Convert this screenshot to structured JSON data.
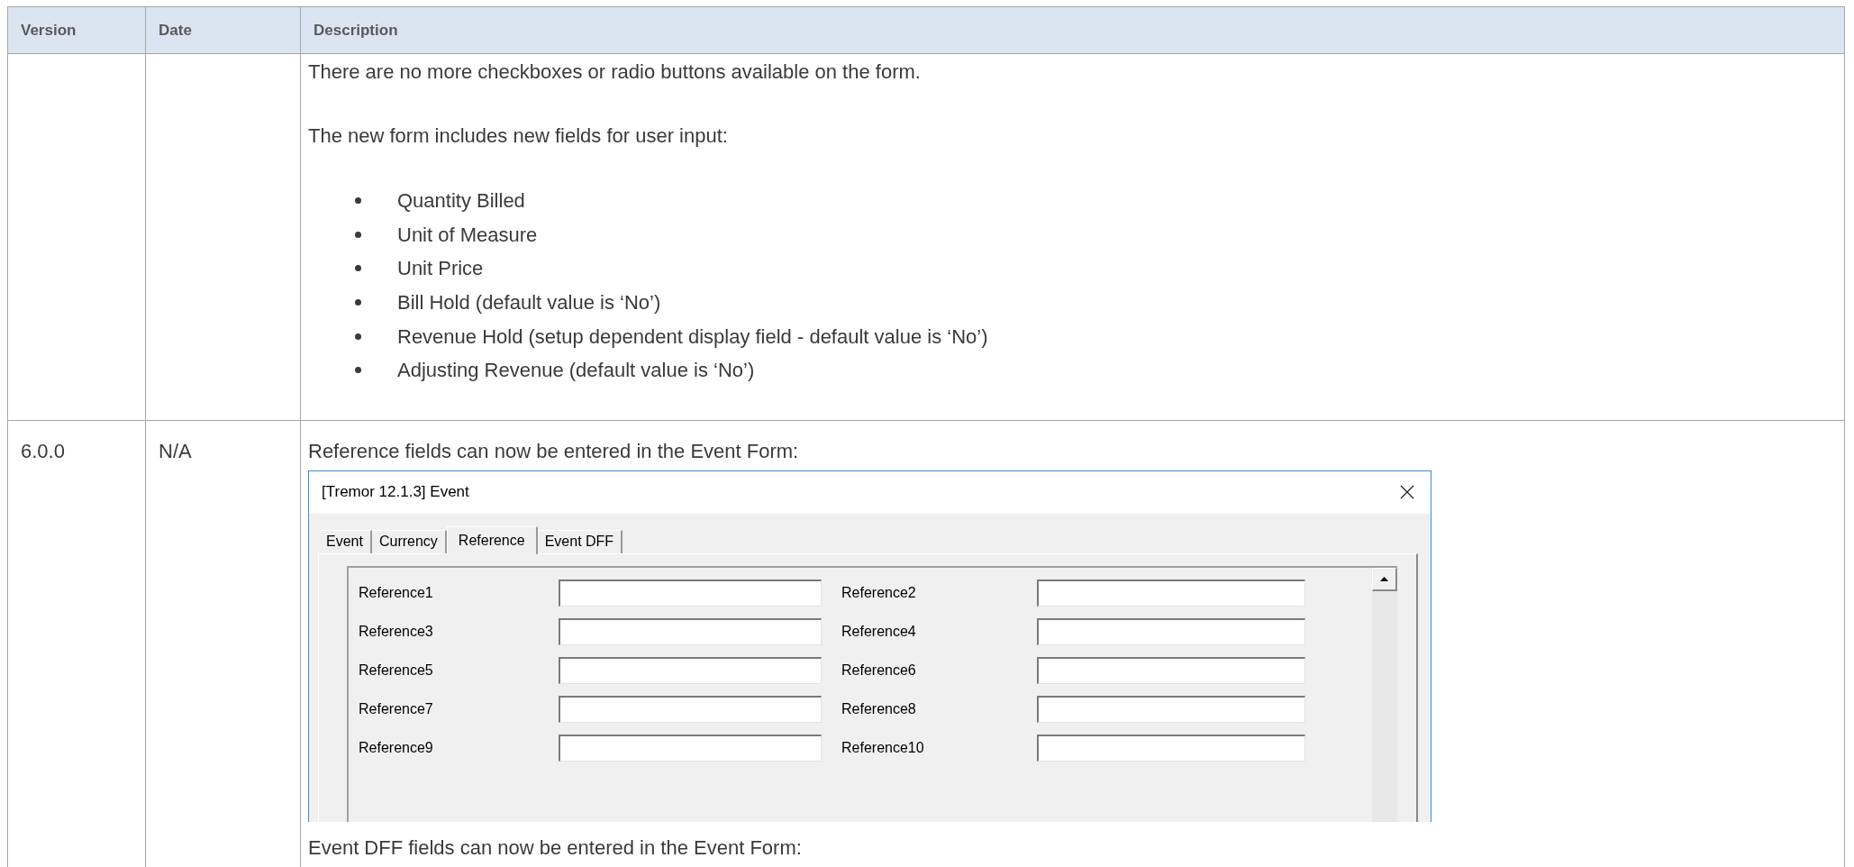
{
  "table": {
    "columns": [
      "Version",
      "Date",
      "Description"
    ],
    "rows": [
      {
        "description": [
          {
            "kind": "paragraph",
            "text": "There are no more checkboxes or radio buttons available on the form."
          },
          {
            "kind": "paragraph",
            "text": "The new form includes new fields for user input:"
          },
          {
            "kind": "bullets",
            "items": [
              "Quantity Billed",
              "Unit of Measure",
              "Unit Price",
              "Bill Hold (default value is ‘No’)",
              "Revenue Hold (setup dependent display field - default value is ‘No’)",
              "Adjusting Revenue (default value is ‘No’)"
            ]
          }
        ]
      },
      {
        "version": "6.0.0",
        "date": "N/A",
        "description": [
          {
            "kind": "paragraph",
            "text": "Reference fields can now be entered in the Event Form:"
          },
          {
            "kind": "dialog",
            "title": "[Tremor 12.1.3] Event",
            "tabs": [
              {
                "label": "Event",
                "selected": false
              },
              {
                "label": "Currency",
                "selected": false
              },
              {
                "label": "Reference",
                "selected": true
              },
              {
                "label": "Event DFF",
                "selected": false
              }
            ],
            "fields": [
              {
                "label": "Reference1"
              },
              {
                "label": "Reference2"
              },
              {
                "label": "Reference3"
              },
              {
                "label": "Reference4"
              },
              {
                "label": "Reference5"
              },
              {
                "label": "Reference6"
              },
              {
                "label": "Reference7"
              },
              {
                "label": "Reference8"
              },
              {
                "label": "Reference9"
              },
              {
                "label": "Reference10"
              }
            ]
          },
          {
            "kind": "paragraph",
            "text": "Event DFF fields can now be entered in the Event Form:"
          }
        ]
      }
    ]
  }
}
